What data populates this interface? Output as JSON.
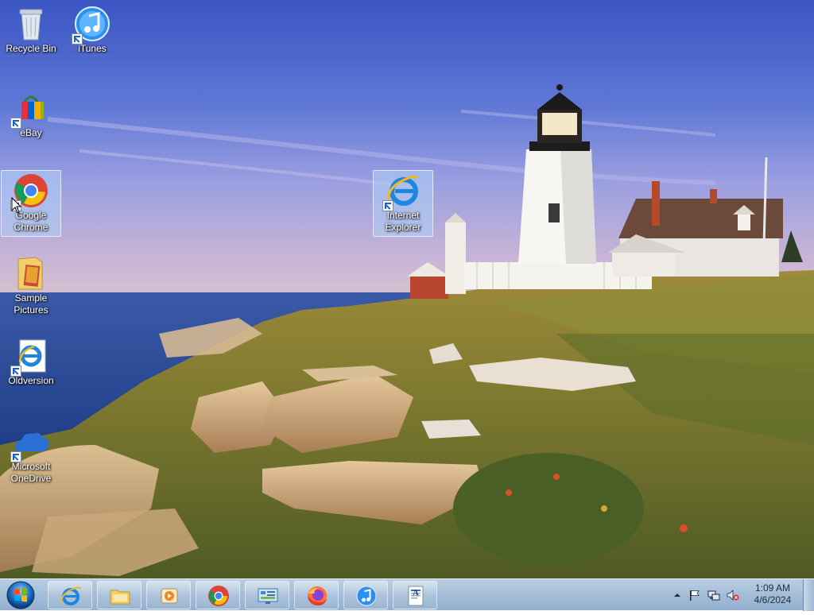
{
  "desktop": {
    "icons": [
      {
        "label": "Recycle Bin"
      },
      {
        "label": "iTunes"
      },
      {
        "label": "eBay"
      },
      {
        "label": "Google Chrome"
      },
      {
        "label": "Internet Explorer"
      },
      {
        "label": "Sample Pictures"
      },
      {
        "label": "Oldversion"
      },
      {
        "label": "Microsoft OneDrive"
      }
    ],
    "selected_icons": [
      "Google Chrome",
      "Internet Explorer"
    ]
  },
  "taskbar": {
    "start": {
      "icon": "windows-logo-icon"
    },
    "pinned": [
      {
        "icon": "internet-explorer-icon"
      },
      {
        "icon": "file-explorer-icon"
      },
      {
        "icon": "media-player-icon"
      },
      {
        "icon": "chrome-icon"
      },
      {
        "icon": "control-panel-icon"
      },
      {
        "icon": "firefox-icon"
      },
      {
        "icon": "itunes-icon"
      },
      {
        "icon": "wordpad-icon"
      }
    ],
    "tray": {
      "icons": [
        "show-hidden-icons",
        "action-center-flag-icon",
        "network-icon",
        "volume-muted-icon"
      ],
      "time": "1:09 AM",
      "date": "4/6/2024"
    }
  },
  "colors": {
    "selection": "#afd2f5",
    "taskbar": "#a6bfd9",
    "sky_top": "#3c58c6",
    "sea": "#2c4ea0"
  }
}
